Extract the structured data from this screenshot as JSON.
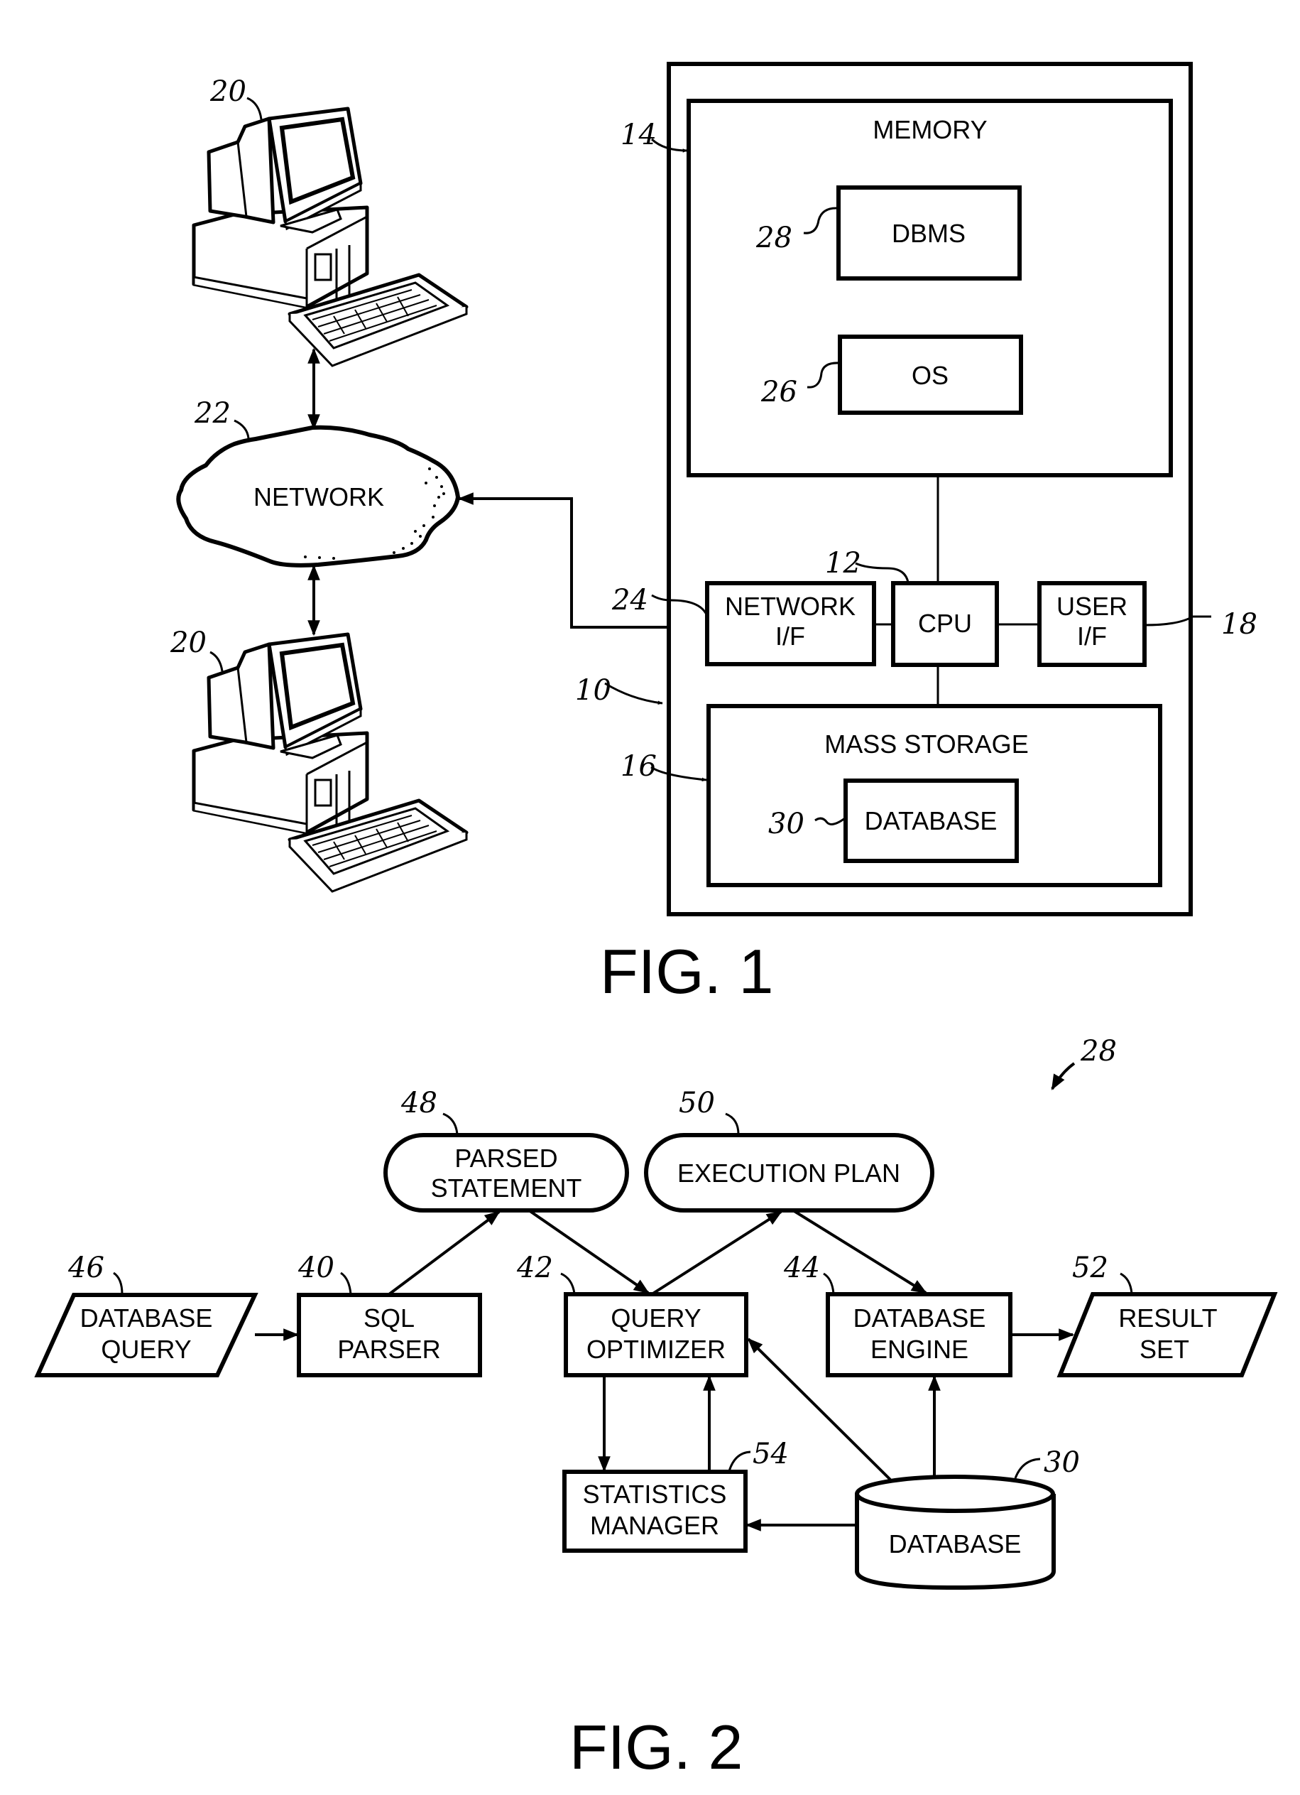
{
  "colors": {
    "ink": "#000000",
    "paper": "#ffffff"
  },
  "fig1": {
    "caption": "FIG. 1",
    "client_computers": [
      {
        "ref": "20",
        "icon": "desktop-computer-icon"
      },
      {
        "ref": "20",
        "icon": "desktop-computer-icon"
      }
    ],
    "network": {
      "label": "NETWORK",
      "ref": "22",
      "icon": "cloud-icon"
    },
    "server": {
      "ref": "10"
    },
    "memory": {
      "label": "MEMORY",
      "ref": "14"
    },
    "dbms": {
      "label": "DBMS",
      "ref": "28"
    },
    "os": {
      "label": "OS",
      "ref": "26"
    },
    "network_if": {
      "line1": "NETWORK",
      "line2": "I/F",
      "ref": "24"
    },
    "cpu": {
      "label": "CPU",
      "ref": "12"
    },
    "user_if": {
      "line1": "USER",
      "line2": "I/F",
      "ref": "18"
    },
    "mass_storage": {
      "label": "MASS STORAGE",
      "ref": "16"
    },
    "database": {
      "label": "DATABASE",
      "ref": "30"
    }
  },
  "fig2": {
    "caption": "FIG. 2",
    "ref": "28",
    "database_query": {
      "line1": "DATABASE",
      "line2": "QUERY",
      "ref": "46"
    },
    "sql_parser": {
      "line1": "SQL",
      "line2": "PARSER",
      "ref": "40"
    },
    "parsed_statement": {
      "line1": "PARSED",
      "line2": "STATEMENT",
      "ref": "48"
    },
    "execution_plan": {
      "label": "EXECUTION PLAN",
      "ref": "50"
    },
    "query_optimizer": {
      "line1": "QUERY",
      "line2": "OPTIMIZER",
      "ref": "42"
    },
    "database_engine": {
      "line1": "DATABASE",
      "line2": "ENGINE",
      "ref": "44"
    },
    "result_set": {
      "line1": "RESULT",
      "line2": "SET",
      "ref": "52"
    },
    "statistics_manager": {
      "line1": "STATISTICS",
      "line2": "MANAGER",
      "ref": "54"
    },
    "database": {
      "label": "DATABASE",
      "ref": "30"
    }
  }
}
